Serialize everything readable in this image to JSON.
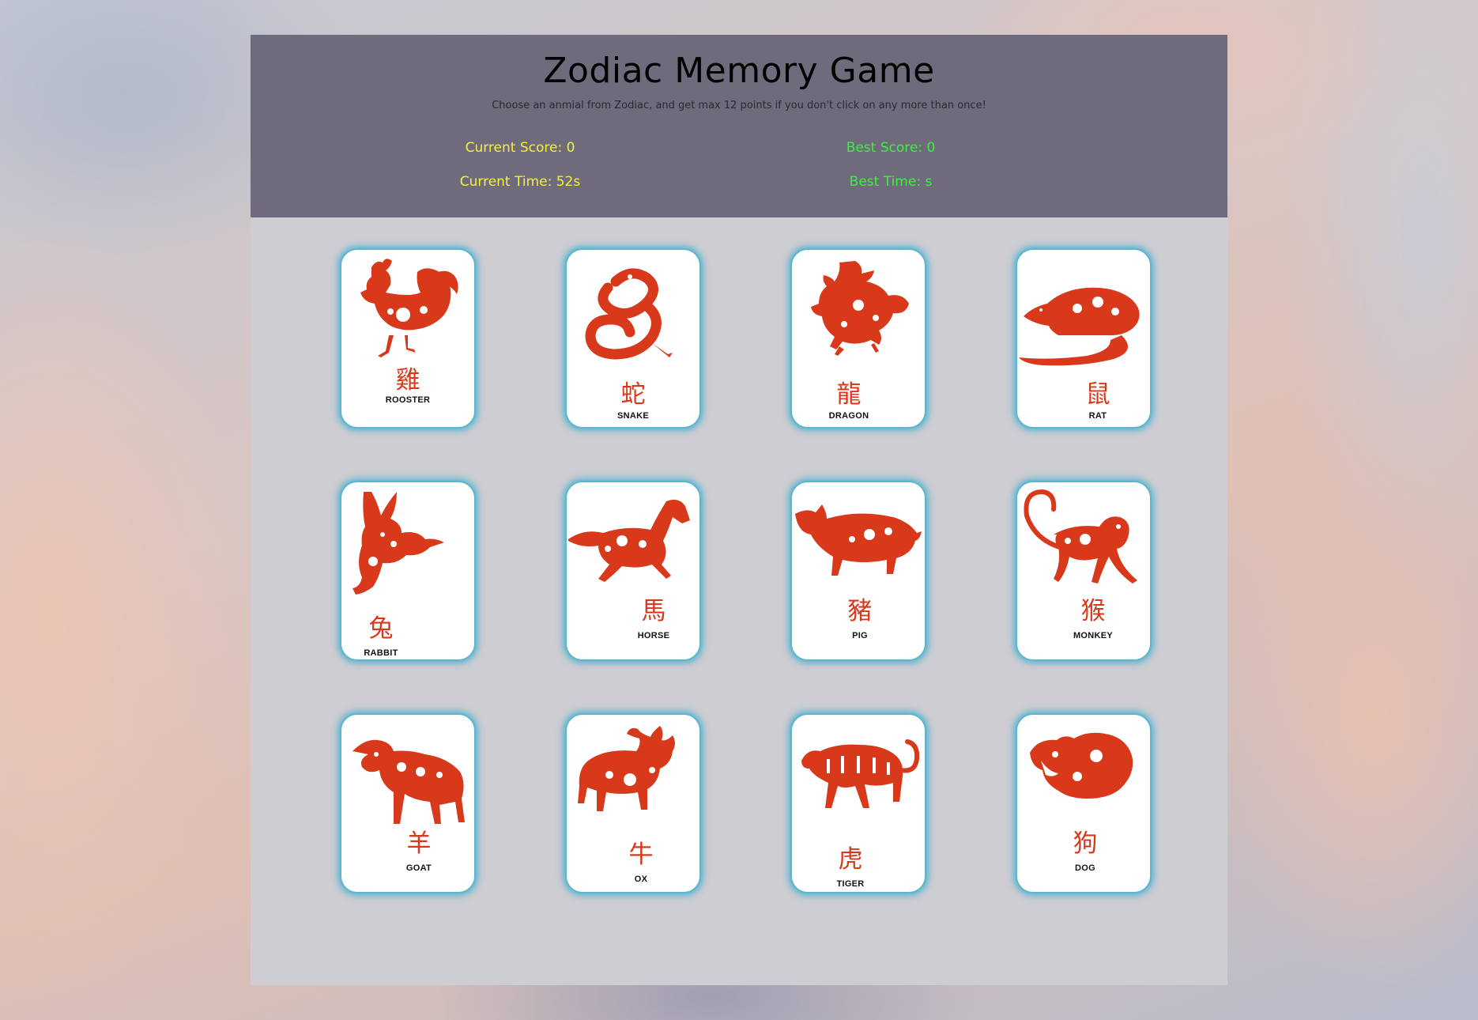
{
  "header": {
    "title": "Zodiac Memory Game",
    "subtitle": "Choose an anmial from Zodiac, and get max 12 points if you don't click on any more than once!"
  },
  "stats": {
    "current_score": "Current Score: 0",
    "best_score": "Best Score: 0",
    "current_time": "Current Time: 52s",
    "best_time": "Best Time: s"
  },
  "colors": {
    "header_bg": "#6f6b7d",
    "board_bg": "#cdcdd2",
    "current_stat": "#f2f23c",
    "best_stat": "#3cf23c",
    "animal_red": "#d8391a",
    "card_glow": "#48b0d2"
  },
  "cards": [
    {
      "hanzi": "雞",
      "name": "ROOSTER",
      "icon": "rooster-icon"
    },
    {
      "hanzi": "蛇",
      "name": "SNAKE",
      "icon": "snake-icon"
    },
    {
      "hanzi": "龍",
      "name": "DRAGON",
      "icon": "dragon-icon"
    },
    {
      "hanzi": "鼠",
      "name": "RAT",
      "icon": "rat-icon"
    },
    {
      "hanzi": "兔",
      "name": "RABBIT",
      "icon": "rabbit-icon"
    },
    {
      "hanzi": "馬",
      "name": "HORSE",
      "icon": "horse-icon"
    },
    {
      "hanzi": "豬",
      "name": "PIG",
      "icon": "pig-icon"
    },
    {
      "hanzi": "猴",
      "name": "MONKEY",
      "icon": "monkey-icon"
    },
    {
      "hanzi": "羊",
      "name": "GOAT",
      "icon": "goat-icon"
    },
    {
      "hanzi": "牛",
      "name": "OX",
      "icon": "ox-icon"
    },
    {
      "hanzi": "虎",
      "name": "TIGER",
      "icon": "tiger-icon"
    },
    {
      "hanzi": "狗",
      "name": "DOG",
      "icon": "dog-icon"
    }
  ]
}
